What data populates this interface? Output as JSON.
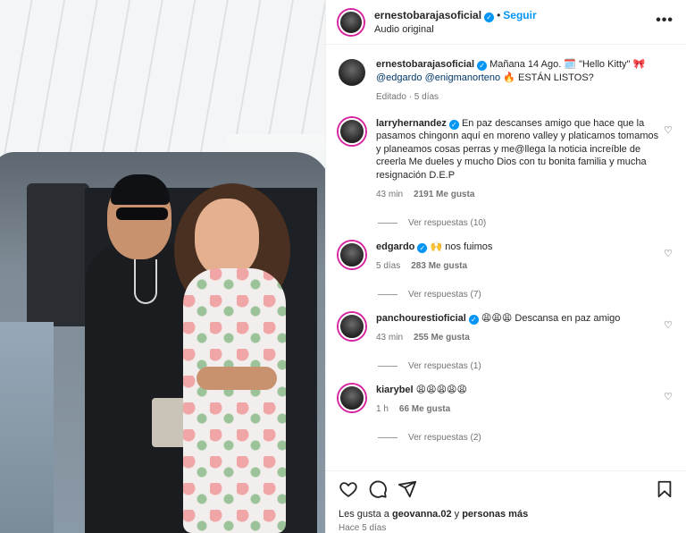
{
  "post": {
    "username": "ernestobarajasoficial",
    "follow_label": "Seguir",
    "audio": "Audio original",
    "caption_prefix": "Mañana 14 Ago.",
    "caption_mid": "\"Hello Kitty\"",
    "mention_1": "@edgardo",
    "mention_2": "@enigmanorteno",
    "caption_end": "ESTÁN LISTOS?",
    "edited": "Editado · 5 días"
  },
  "comments": [
    {
      "username": "larryhernandez",
      "text": "En paz descanses amigo que hace que la pasamos chingonn aquí en moreno valley y platicamos tomamos y planeamos cosas perras y me@llega la noticia increíble de creerla Me dueles y mucho Dios con tu bonita familia y mucha resignación D.E.P",
      "time": "43 min",
      "likes": "2191 Me gusta",
      "replies": "Ver respuestas (10)"
    },
    {
      "username": "edgardo",
      "text": "🙌 nos fuimos",
      "time": "5 días",
      "likes": "283 Me gusta",
      "replies": "Ver respuestas (7)"
    },
    {
      "username": "panchourestioficial",
      "text": "😩😩😩 Descansa en paz amigo",
      "time": "43 min",
      "likes": "255 Me gusta",
      "replies": "Ver respuestas (1)"
    },
    {
      "username": "kiarybel",
      "text": "😩😩😩😩😩",
      "time": "1 h",
      "likes": "66 Me gusta",
      "replies": "Ver respuestas (2)"
    }
  ],
  "footer": {
    "likes_prefix": "Les gusta a",
    "liker": "geovanna.02",
    "likes_and": "y",
    "likes_more": "personas más",
    "time": "Hace 5 días"
  },
  "icons": {
    "more": "more-options-icon",
    "heart": "heart-icon",
    "comment": "comment-icon",
    "share": "share-icon",
    "save": "bookmark-icon",
    "verified": "verified-badge-icon"
  },
  "colors": {
    "accent": "#0095f6",
    "mention": "#00376b",
    "muted": "#737373"
  }
}
